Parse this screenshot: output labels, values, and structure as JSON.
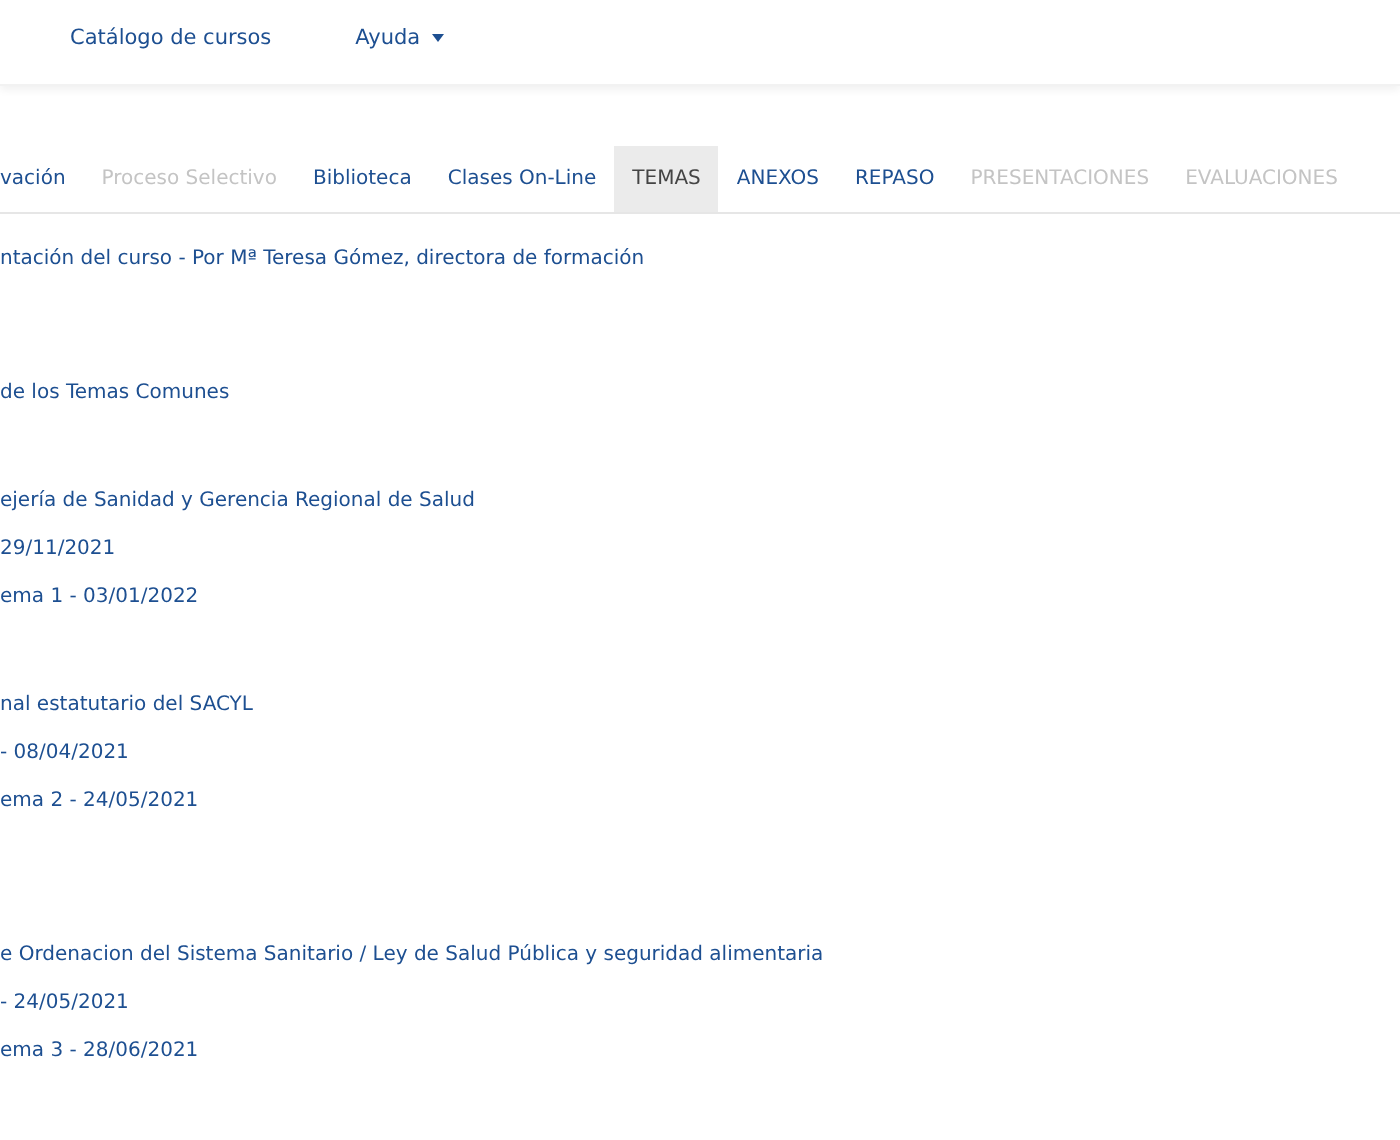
{
  "navbar": {
    "items": [
      {
        "label": "Catálogo de cursos",
        "dropdown": false
      },
      {
        "label": "Ayuda",
        "dropdown": true
      }
    ]
  },
  "tabs": [
    {
      "label": "vación",
      "selected": false,
      "disabled": false
    },
    {
      "label": "Proceso Selectivo",
      "selected": false,
      "disabled": true
    },
    {
      "label": "Biblioteca",
      "selected": false,
      "disabled": false
    },
    {
      "label": "Clases On-Line",
      "selected": false,
      "disabled": false
    },
    {
      "label": "TEMAS",
      "selected": true,
      "disabled": false
    },
    {
      "label": "ANEXOS",
      "selected": false,
      "disabled": false
    },
    {
      "label": "REPASO",
      "selected": false,
      "disabled": false
    },
    {
      "label": "PRESENTACIONES",
      "selected": false,
      "disabled": true
    },
    {
      "label": "EVALUACIONES",
      "selected": false,
      "disabled": true
    }
  ],
  "sections": [
    {
      "links": [
        "ntación del curso - Por Mª Teresa Gómez, directora de formación"
      ]
    },
    {
      "links": [
        "de los Temas Comunes"
      ]
    },
    {
      "links": [
        "ejería de Sanidad y Gerencia Regional de Salud",
        "29/11/2021",
        "ema 1 - 03/01/2022"
      ]
    },
    {
      "links": [
        "nal estatutario del SACYL",
        "- 08/04/2021",
        "ema 2 - 24/05/2021"
      ]
    },
    {
      "links": [
        "e Ordenacion del Sistema Sanitario / Ley de Salud Pública y seguridad alimentaria",
        "- 24/05/2021",
        "ema 3 - 28/06/2021"
      ]
    }
  ]
}
